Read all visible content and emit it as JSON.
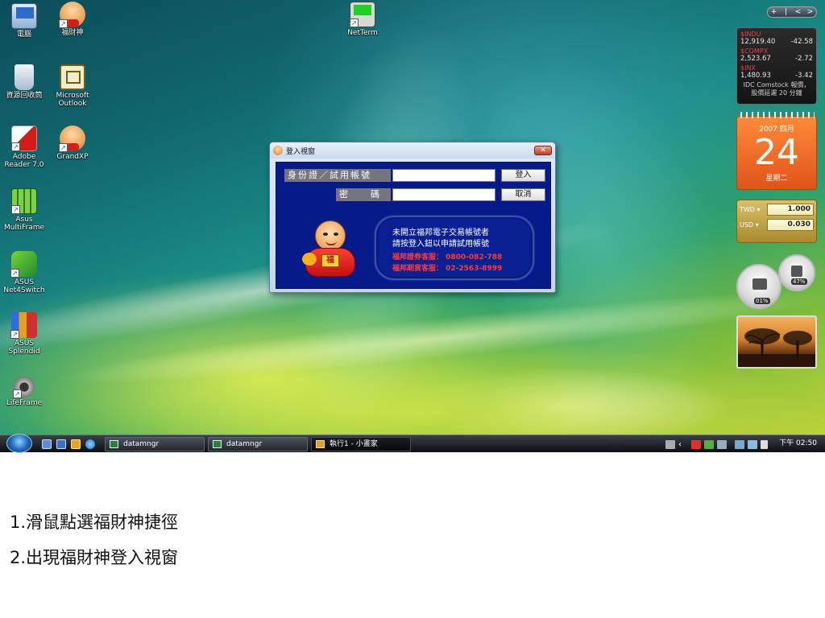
{
  "desktop": {
    "icons": [
      {
        "label": "電腦",
        "icon": "computer-icon"
      },
      {
        "label": "福財神",
        "icon": "fortune-god-icon"
      },
      {
        "label": "NetTerm",
        "icon": "terminal-icon"
      },
      {
        "label": "資源回收筒",
        "icon": "recycle-bin-icon"
      },
      {
        "label": "Microsoft Outlook",
        "icon": "outlook-icon"
      },
      {
        "label": "Adobe Reader 7.0",
        "icon": "pdf-icon"
      },
      {
        "label": "GrandXP",
        "icon": "fortune-god-icon"
      },
      {
        "label": "Asus MultiFrame",
        "icon": "multiframe-icon"
      },
      {
        "label": "ASUS Net4Switch",
        "icon": "network-switch-icon"
      },
      {
        "label": "ASUS Splendid",
        "icon": "splendid-icon"
      },
      {
        "label": "LifeFrame",
        "icon": "webcam-icon"
      }
    ]
  },
  "sidebar": {
    "controls": [
      "+",
      "|",
      "<",
      ">"
    ],
    "stocks": {
      "rows": [
        {
          "symbol": "$INDU",
          "price": "12,919.40",
          "change": "-42.58"
        },
        {
          "symbol": "$COMPX",
          "price": "2,523.67",
          "change": "-2.72"
        },
        {
          "symbol": "$INX",
          "price": "1,480.93",
          "change": "-3.42"
        }
      ],
      "footer": "IDC Comstock 報價，股價延遲 20 分鐘"
    },
    "calendar": {
      "year_month": "2007 四月",
      "day": "24",
      "weekday": "星期二"
    },
    "currency": {
      "rows": [
        {
          "code": "TWD ▾",
          "value": "1.000"
        },
        {
          "code": "USD ▾",
          "value": "0.030"
        }
      ]
    },
    "meters": {
      "cpu": "01%",
      "memory": "47%"
    }
  },
  "login_window": {
    "title": "登入視窗",
    "close_label": "✕",
    "id_label": "身份證／試用帳號",
    "id_value": "",
    "password_label": "密　　碼",
    "password_value": "",
    "login_button": "登入",
    "cancel_button": "取消",
    "promo": {
      "line1": "未開立福邦電子交易帳號者",
      "line2": "請按登入鈕以申請試用帳號",
      "line3": "福邦證券客服： 0800-082-788",
      "line4": "福邦期貨客服： 02-2563-8999"
    },
    "mascot_badge": "福"
  },
  "taskbar": {
    "tasks": [
      {
        "label": "datamngr",
        "active": false
      },
      {
        "label": "datamngr",
        "active": false
      },
      {
        "label": "執行1 - 小畫家",
        "active": true
      }
    ],
    "clock": "下午 02:50"
  },
  "instructions": {
    "step1": "1.滑鼠點選福財神捷徑",
    "step2": "2.出現福財神登入視窗"
  },
  "colors": {
    "dialog_body": "#071a8a",
    "promo_red": "#ff3b3b",
    "calendar_orange": "#f07030"
  }
}
